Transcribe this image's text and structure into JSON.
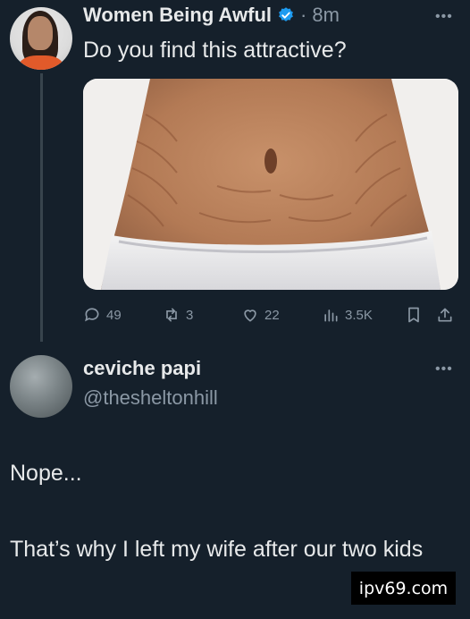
{
  "post": {
    "author_name": "Women Being Awful",
    "time": "8m",
    "text": "Do you find this attractive?",
    "actions": {
      "replies": "49",
      "reposts": "3",
      "likes": "22",
      "views": "3.5K"
    }
  },
  "reply": {
    "author_name": "ceviche papi",
    "handle": "@thesheltonhill",
    "line1": "Nope...",
    "line2": "That’s why I left my wife after our two kids"
  },
  "watermark": "ipv69.com",
  "colors": {
    "background": "#15202b",
    "text": "#e7e9ea",
    "muted": "#8b98a5",
    "verified": "#1d9bf0"
  },
  "icons": {
    "more": "more-icon",
    "verified": "verified-badge-icon",
    "reply": "reply-icon",
    "repost": "repost-icon",
    "like": "heart-icon",
    "views": "views-icon",
    "bookmark": "bookmark-icon",
    "share": "share-icon"
  }
}
